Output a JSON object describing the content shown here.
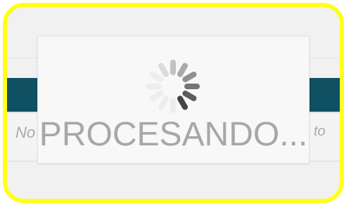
{
  "theme": {
    "highlight_border": "#ffff1a",
    "header_bar": "#0f5063",
    "page_background": "#f1f1f1",
    "overlay_background": "#f8f8f8",
    "label_color": "#a7a7a7",
    "spinner_color": "#444444"
  },
  "background": {
    "left_fragment": "No",
    "right_fragment": "to"
  },
  "loading_overlay": {
    "label": "PROCESANDO...",
    "spinner_icon": "spinner-icon"
  }
}
